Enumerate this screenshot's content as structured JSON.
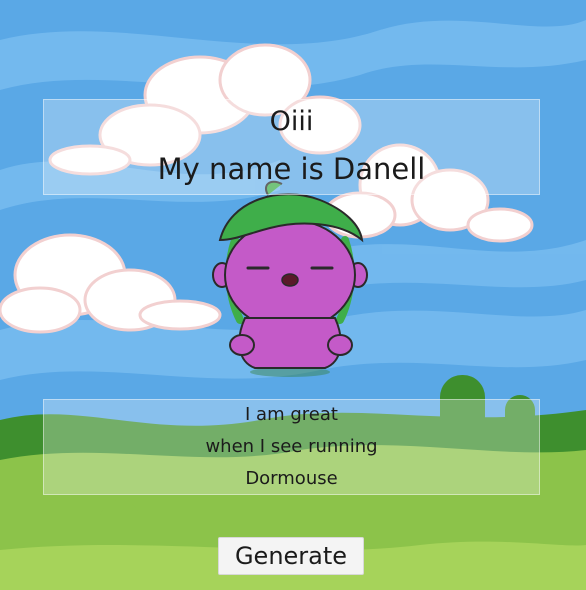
{
  "greeting": "Oiii",
  "name_line": "My name is Danell",
  "description": {
    "line1": "I am great",
    "line2": "when I see running",
    "line3": "Dormouse"
  },
  "generate_label": "Generate",
  "colors": {
    "sky": "#5aa8e6",
    "hill_dark": "#3e8f2e",
    "hill_light": "#8cc34a",
    "creature_body": "#c45ac8",
    "leaf_hat": "#3fae4a"
  }
}
